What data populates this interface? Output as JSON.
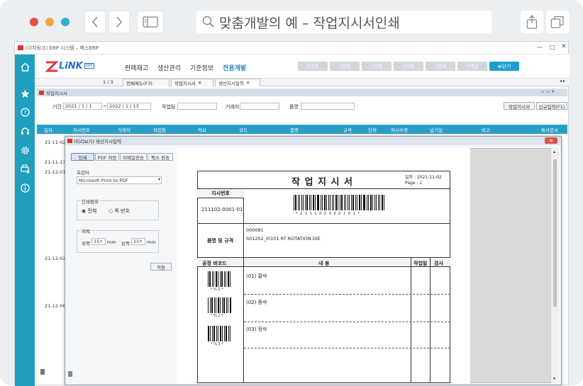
{
  "browser": {
    "address": "맞춤개발의 예 – 작업지시서인쇄"
  },
  "app": {
    "window_title": "(이지링크) ERP 시스템 – 메스ERP",
    "logo_text": "LiNK",
    "logo_badge": "ERP",
    "menu": [
      "판매재고",
      "생산관리",
      "기준정보",
      "전용개발"
    ],
    "toolbar": [
      "조회",
      "입력",
      "저장",
      "삭제",
      "인쇄",
      "엑셀",
      "닫기"
    ],
    "page_counter": "1 / 3",
    "tabs": [
      "전체메뉴(F3)",
      "작업지시서",
      "생산지시입력"
    ],
    "form_title": "작업지시서",
    "filter": {
      "period_label": "기간",
      "date_from": "2021 / 1 / 1",
      "date_to": "2022 / 1 / 13",
      "worker_label": "작업팀",
      "client_label": "거래처",
      "item_label": "품명",
      "btn_print": "작업지시서",
      "btn_new": "신규입력(F1)"
    },
    "grid_headers": [
      "일자",
      "지시번호",
      "거래처",
      "작업팀",
      "적요",
      "코드",
      "품명",
      "규격",
      "단위",
      "지시수량",
      "납기일",
      "비고",
      "특사문서"
    ],
    "grid_rows": [
      "21-11-02",
      "21-11-13",
      "21-12-01",
      "21-12-02",
      "21-12-06"
    ]
  },
  "dialog": {
    "title": "(미리보기) 생산지시입력",
    "tabs": [
      "인쇄",
      "PDF 저장",
      "이메일전송",
      "팩스 전송"
    ],
    "printer_label": "프린터",
    "printer_value": "Microsoft Print to PDF",
    "range_label": "인쇄범위",
    "range_all": "전체",
    "range_page": "쪽 번호",
    "margin_label": "여백",
    "margin_top_label": "위쪽",
    "margin_top": "15",
    "margin_left_label": "왼쪽",
    "margin_left": "15",
    "unit": "mm",
    "apply": "적용"
  },
  "document": {
    "title": "작 업 지 시 서",
    "date": "일자 : 2021-11-02",
    "page": "Page :   1",
    "order_no_label": "지시번호",
    "order_no": "211102-0001-01",
    "barcode_text": "* 2 1 1 1 0 2 0 0 0 1 0 1 *",
    "item_label": "품명 및 규격",
    "item_code": "000081",
    "item_name": "S01202_I0101 RT ROTATION DIE",
    "col_process": "공정 바코드",
    "col_content": "내   용",
    "col_workday": "작업일",
    "col_check": "검사",
    "steps": [
      {
        "name": "(01) 황삭",
        "code": "* % 1 *"
      },
      {
        "name": "(02) 중삭",
        "code": "* % 2 *"
      },
      {
        "name": "(03) 정삭",
        "code": "* % 3 *"
      }
    ]
  },
  "colors": {
    "sidebar": "#1f9fbd",
    "grid_header": "#2a9fc6",
    "toolbar_active": "#1c9fd0"
  }
}
